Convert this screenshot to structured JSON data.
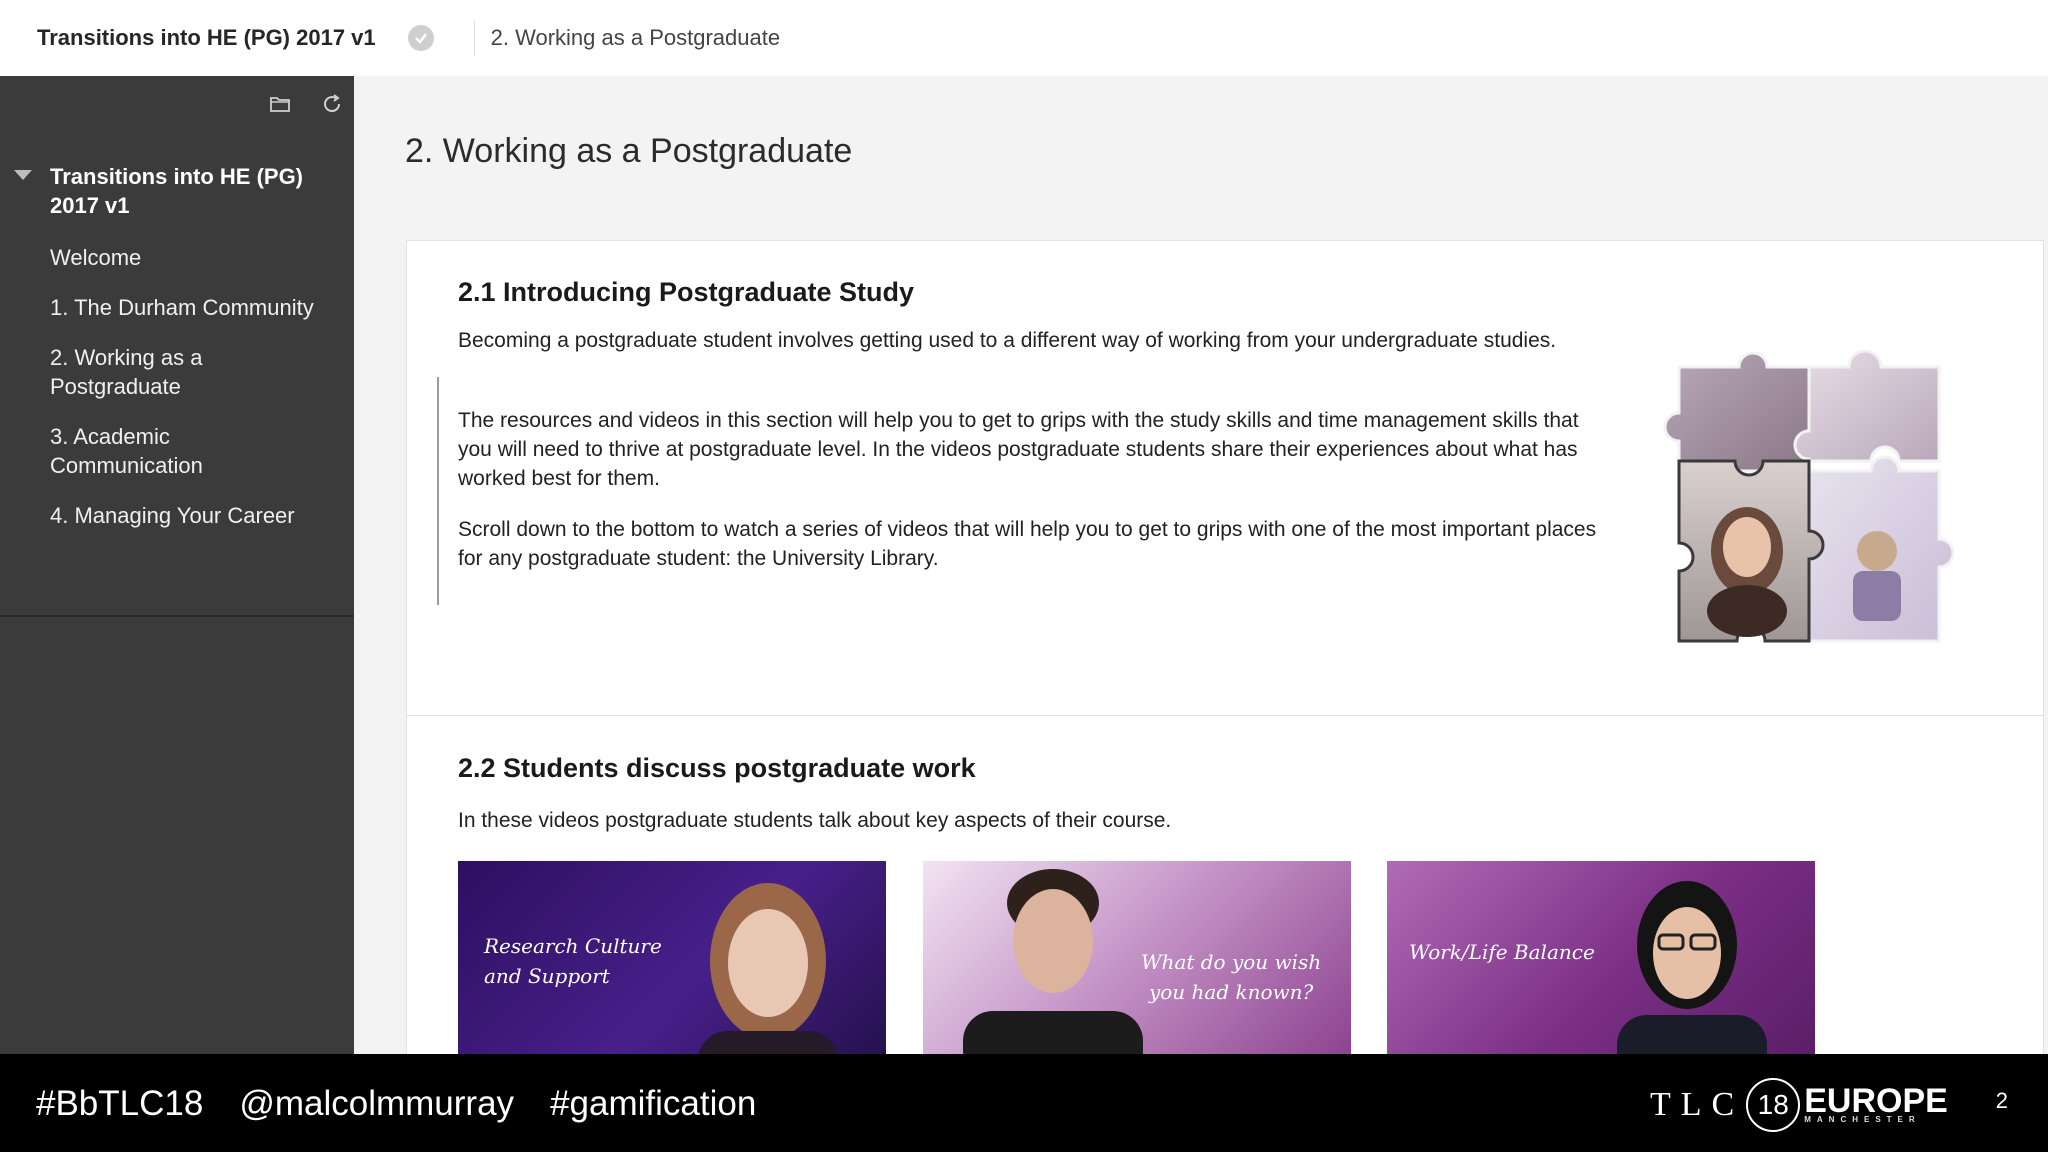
{
  "header": {
    "course_name": "Transitions into HE (PG) 2017 v1",
    "breadcrumb": "2. Working as a Postgraduate"
  },
  "sidebar": {
    "course_title": "Transitions into HE (PG) 2017 v1",
    "items": [
      {
        "label": "Welcome"
      },
      {
        "label": "1. The Durham Community"
      },
      {
        "label": "2. Working as a Postgraduate"
      },
      {
        "label": "3. Academic Communication"
      },
      {
        "label": "4. Managing Your Career"
      }
    ]
  },
  "main": {
    "page_title": "2. Working as a Postgraduate",
    "section1": {
      "heading": "2.1 Introducing Postgraduate Study",
      "paragraphs": [
        "Becoming a postgraduate student involves getting used to a different way of working from your undergraduate studies.",
        "The resources and videos in this section will help you to get to grips with the study skills and time management skills that you will need to thrive at postgraduate level. In the videos postgraduate students share their experiences about what has worked best for them.",
        "Scroll down to the bottom to watch a series of videos that will help you to get to grips with one of the most important places for any postgraduate student: the University Library."
      ]
    },
    "section2": {
      "heading": "2.2 Students discuss postgraduate work",
      "intro": "In these videos postgraduate students talk about key aspects of their course.",
      "videos": [
        {
          "title_line1": "Research Culture",
          "title_line2": "and Support"
        },
        {
          "title_line1": "What do you wish",
          "title_line2": "you had known?"
        },
        {
          "title_line1": "Work/Life Balance",
          "title_line2": ""
        }
      ]
    }
  },
  "footer": {
    "tags": [
      "#BbTLC18",
      "@malcolmmurray",
      "#gamification"
    ],
    "logo_tlc": "TLC",
    "logo_num": "18",
    "logo_europe": "EUROPE",
    "logo_city": "MANCHESTER",
    "page_number": "2"
  },
  "colors": {
    "sidebar_bg": "#3b3b3b",
    "main_bg": "#f3f3f3",
    "footer_bg": "#000000",
    "video_purple": "#3a1570"
  }
}
